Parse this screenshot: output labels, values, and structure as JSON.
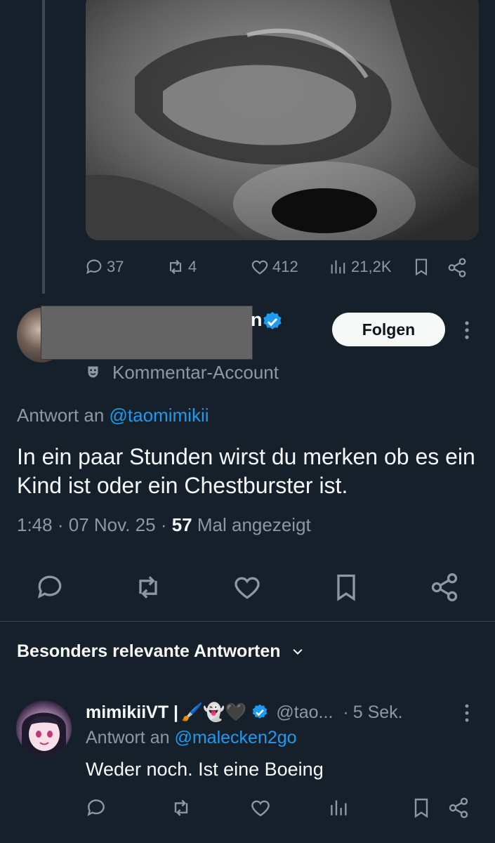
{
  "parent_tweet": {
    "media_alt": "ultrasound-image",
    "stats": {
      "replies": "37",
      "retweets": "4",
      "likes": "412",
      "views": "21,2K"
    }
  },
  "main_tweet": {
    "author_name_visible": "n",
    "follow_label": "Folgen",
    "community_label": "Kommentar-Account",
    "reply_prefix": "Antwort an",
    "reply_handle": "@taomimikii",
    "text": "In ein paar Stunden wirst du merken ob es ein Kind ist oder ein Chestburster ist.",
    "time": "1:48",
    "date": "07 Nov. 25",
    "views_count": "57",
    "views_label": "Mal angezeigt",
    "sep": "·"
  },
  "section": {
    "title": "Besonders relevante Antworten"
  },
  "reply": {
    "name": "mimikiiVT |",
    "name_emojis": "🖌️👻🖤",
    "handle": "@tao...",
    "dot": "·",
    "time": "5 Sek.",
    "reply_prefix": "Antwort an",
    "reply_handle": "@malecken2go",
    "text": "Weder noch. Ist eine Boeing"
  },
  "colors": {
    "background": "#15202b",
    "accent": "#1d9bf0",
    "muted": "#8b98a5",
    "text": "#f7f9f9"
  }
}
